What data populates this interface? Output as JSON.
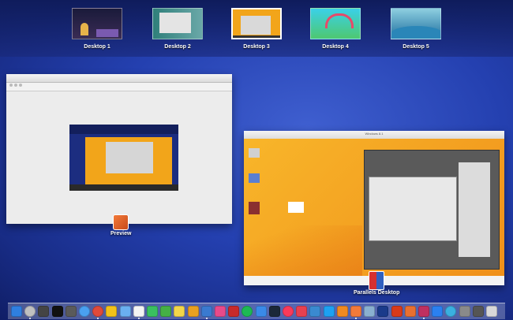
{
  "spaces": [
    {
      "label": "Desktop 1",
      "active": false
    },
    {
      "label": "Desktop 2",
      "active": false
    },
    {
      "label": "Desktop 3",
      "active": true
    },
    {
      "label": "Desktop 4",
      "active": false
    },
    {
      "label": "Desktop 5",
      "active": false
    }
  ],
  "windows": {
    "preview": {
      "app_label": "Preview",
      "icon": "preview-icon"
    },
    "parallels": {
      "app_label": "Parallels Desktop",
      "icon": "parallels-icon",
      "window_title": "Windows 8.1"
    }
  },
  "dock": {
    "apps": [
      "finder",
      "launchpad",
      "stats",
      "terminal",
      "cpu-meter",
      "safari",
      "chrome",
      "photos",
      "mail",
      "calendar",
      "messages",
      "facetime",
      "notes",
      "chrome-2",
      "keynote",
      "itunes",
      "parallels",
      "spotify",
      "app-store",
      "steam",
      "music",
      "pocket",
      "airmail",
      "twitter",
      "books",
      "preview",
      "iphoto",
      "photoshop",
      "office",
      "candy",
      "gift",
      "messenger",
      "airdrop",
      "gears",
      "calculator",
      "trash"
    ],
    "running_dots": [
      1,
      6,
      9,
      14,
      25,
      30
    ]
  }
}
